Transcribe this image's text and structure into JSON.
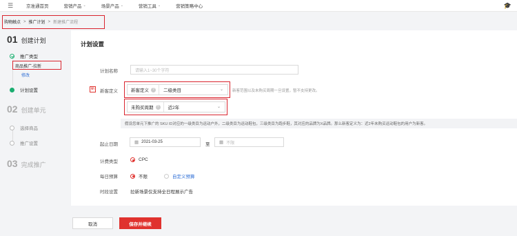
{
  "nav": {
    "items": [
      {
        "label": "京准通首页",
        "caret": ""
      },
      {
        "label": "营销产品",
        "caret": "⌄"
      },
      {
        "label": "场景产品",
        "caret": "⌄"
      },
      {
        "label": "营销工具",
        "caret": "⌄"
      },
      {
        "label": "营销策略中心",
        "caret": ""
      }
    ]
  },
  "breadcrumb": {
    "items": [
      "购物触点",
      "推广计划"
    ],
    "current": "新建推广流程",
    "sep": ">"
  },
  "steps": {
    "step1": {
      "num": "01",
      "title": "创建计划"
    },
    "step1_sub1": "推广类型",
    "step1_sub1_value": "商品推广-拉新",
    "step1_sub1_edit": "修改",
    "step1_sub2": "计划设置",
    "step2": {
      "num": "02",
      "title": "创建单元"
    },
    "step2_sub1": "选择商品",
    "step2_sub2": "推广设置",
    "step3": {
      "num": "03",
      "title": "完成推广"
    }
  },
  "form": {
    "title": "计划设置",
    "plan_name": {
      "label": "计划名称",
      "placeholder": "请输入1~30个字符"
    },
    "new_customer": {
      "badge": "新",
      "label": "新客定义",
      "def_label": "新客定义",
      "def_value": "二级类目",
      "hint": "新客范围以及未购买周期一旦设置，暂不支持更改。",
      "period_label": "未购买周期",
      "period_value": "近2年",
      "note": "假设您单元下推广的 SKU ID对应的一级类目为运动户外，二级类目为运动鞋包，三级类目为跑步鞋，其对应的品牌为X品牌。那么新客定义为：近2年未购买运动鞋包的用户为新客。"
    },
    "date": {
      "label": "起止日期",
      "start": "2021-03-25",
      "to": "至",
      "end_placeholder": "不限"
    },
    "billing": {
      "label": "计费类型",
      "option": "CPC"
    },
    "budget": {
      "label": "每日预算",
      "option1": "不限",
      "option2": "自定义预算"
    },
    "time": {
      "label": "时段设置",
      "value": "拉新场景仅支持全日程展示广告"
    }
  },
  "buttons": {
    "cancel": "取消",
    "save": "保存并继续"
  },
  "colors": {
    "accent": "#e0322e",
    "success": "#1aad70",
    "link": "#2f6fd6",
    "annotation": "#d9232d"
  }
}
